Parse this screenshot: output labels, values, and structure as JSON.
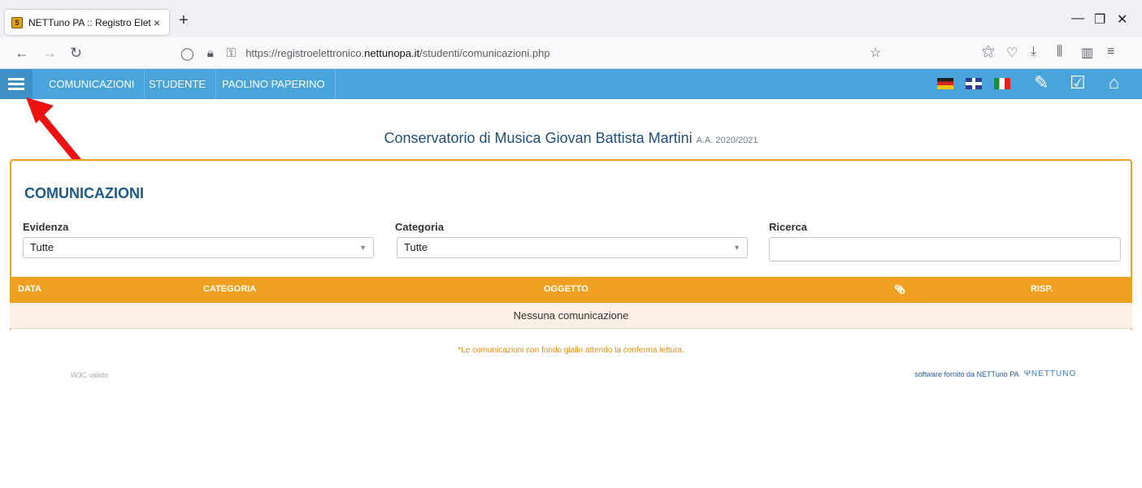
{
  "browser": {
    "tab_title": "NETTuno PA :: Registro Elettroni",
    "tab_favicon": "5",
    "tab_close": "×",
    "new_tab": "+",
    "url_prefix": "https://registroelettronico.",
    "url_domain": "nettunopa.it",
    "url_path": "/studenti/comunicazioni.php"
  },
  "appbar": {
    "nav": [
      "COMUNICAZIONI",
      "STUDENTE",
      "PAOLINO PAPERINO"
    ],
    "accent_color": "#4aa4dc"
  },
  "header": {
    "school": "Conservatorio di Musica Giovan Battista Martini",
    "year": "A.A. 2020/2021"
  },
  "panel": {
    "title": "COMUNICAZIONI",
    "evidenza_label": "Evidenza",
    "evidenza_value": "Tutte",
    "categoria_label": "Categoria",
    "categoria_value": "Tutte",
    "ricerca_label": "Ricerca",
    "ricerca_value": ""
  },
  "table": {
    "headers": [
      "DATA",
      "CATEGORIA",
      "OGGETTO",
      "RISP."
    ],
    "empty": "Nessuna comunicazione",
    "header_color": "#f0a020"
  },
  "footer": {
    "note": "*Le comunicazioni con fondo giallo attendo la conferma lettura.",
    "w3c": "W3C valido",
    "provider": "software fornito da NETTuno PA",
    "logo": "NETTUNO"
  }
}
